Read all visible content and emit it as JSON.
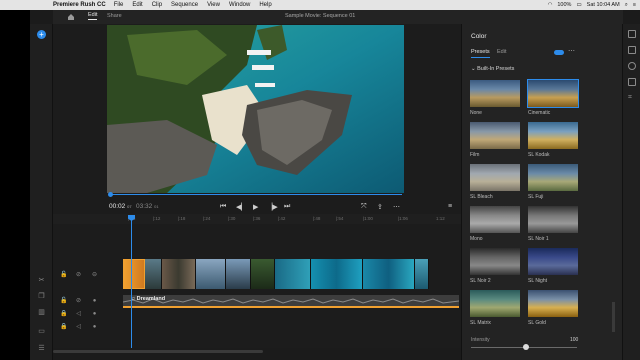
{
  "menubar": {
    "apple": "",
    "app_name": "Premiere Rush CC",
    "items": [
      "File",
      "Edit",
      "Clip",
      "Sequence",
      "View",
      "Window",
      "Help"
    ],
    "battery": "100%",
    "clock": "Sat 10:04 AM"
  },
  "topbar": {
    "edit_tab": "Edit",
    "share_tab": "Share",
    "title": "Sample Movie: Sequence 01"
  },
  "player": {
    "current_time": "00:02",
    "current_frames": "07",
    "duration": "03:32",
    "duration_frames": "01",
    "playhead_fraction": 0.01
  },
  "ruler": {
    "ticks": [
      "|:06",
      "|:12",
      "|:18",
      "|:24",
      "|:30",
      "|:36",
      "|:42",
      "|:48",
      "|:54",
      "|1:00",
      "|1:06",
      "1:12"
    ]
  },
  "timeline": {
    "audio_label": "Dreamland"
  },
  "panel": {
    "title": "Color",
    "tab_presets": "Presets",
    "tab_edit": "Edit",
    "section": "Built-In Presets",
    "presets": [
      "None",
      "Cinematic",
      "Film",
      "SL Kodak",
      "SL Bleach",
      "SL Fuji",
      "Mono",
      "SL Noir 1",
      "SL Noir 2",
      "SL Night",
      "SL Matrix",
      "SL Gold"
    ],
    "intensity_label": "Intensity",
    "intensity_value": "100",
    "toggle_on": true
  },
  "colors": {
    "accent": "#2d8ceb",
    "audio_bar": "#f0a030",
    "clip_selected": "#f0a030"
  }
}
